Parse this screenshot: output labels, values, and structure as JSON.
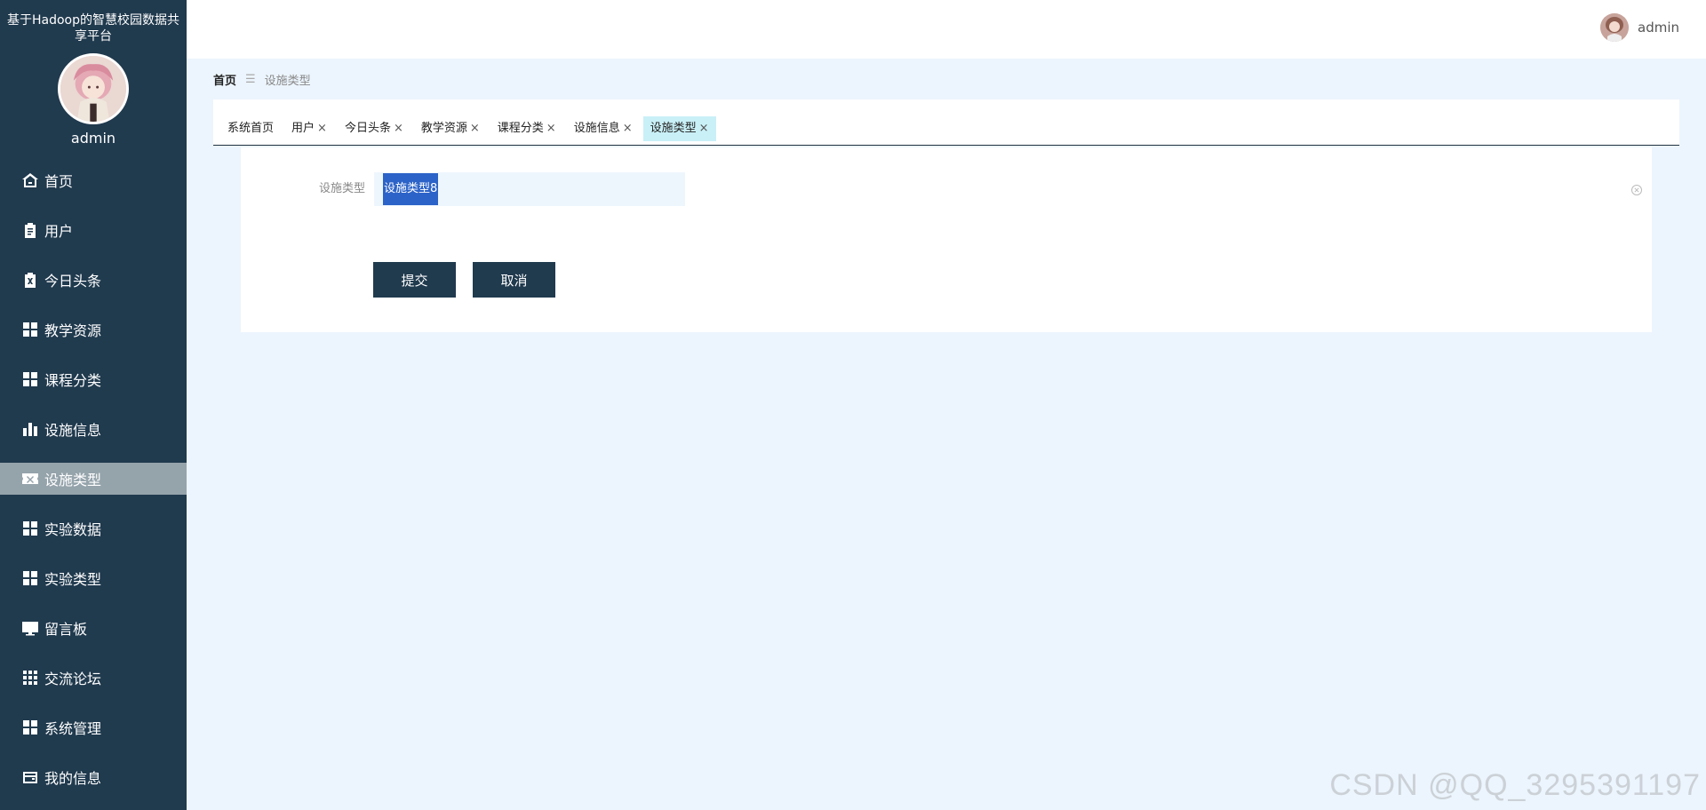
{
  "sidebar": {
    "title": "基于Hadoop的智慧校园数据共享平台",
    "username": "admin",
    "items": [
      {
        "label": "首页",
        "icon": "home-icon"
      },
      {
        "label": "用户",
        "icon": "clipboard-icon"
      },
      {
        "label": "今日头条",
        "icon": "clipboard-x-icon"
      },
      {
        "label": "教学资源",
        "icon": "grid-icon"
      },
      {
        "label": "课程分类",
        "icon": "grid-icon"
      },
      {
        "label": "设施信息",
        "icon": "bar-chart-icon"
      },
      {
        "label": "设施类型",
        "icon": "ticket-icon",
        "active": true
      },
      {
        "label": "实验数据",
        "icon": "grid-icon"
      },
      {
        "label": "实验类型",
        "icon": "grid-icon"
      },
      {
        "label": "留言板",
        "icon": "monitor-icon"
      },
      {
        "label": "交流论坛",
        "icon": "grid-9-icon"
      },
      {
        "label": "系统管理",
        "icon": "grid-icon"
      },
      {
        "label": "我的信息",
        "icon": "wallet-icon"
      }
    ]
  },
  "header": {
    "username": "admin"
  },
  "breadcrumb": {
    "home": "首页",
    "separator": "☰",
    "current": "设施类型"
  },
  "tabs": [
    {
      "label": "系统首页",
      "closable": false
    },
    {
      "label": "用户",
      "closable": true
    },
    {
      "label": "今日头条",
      "closable": true
    },
    {
      "label": "教学资源",
      "closable": true
    },
    {
      "label": "课程分类",
      "closable": true
    },
    {
      "label": "设施信息",
      "closable": true
    },
    {
      "label": "设施类型",
      "closable": true,
      "active": true
    }
  ],
  "tab_close_glyph": "×",
  "form": {
    "field_label": "设施类型",
    "field_value": "设施类型8",
    "submit_label": "提交",
    "cancel_label": "取消"
  },
  "watermark": "CSDN @QQ_3295391197",
  "colors": {
    "sidebar_bg": "#203a4e",
    "active_menu_bg": "#95a3ab",
    "page_bg": "#ecf5fd",
    "button_bg": "#203a4e",
    "active_tab_bg": "#c9f0f7",
    "selection": "#2c63c8"
  }
}
